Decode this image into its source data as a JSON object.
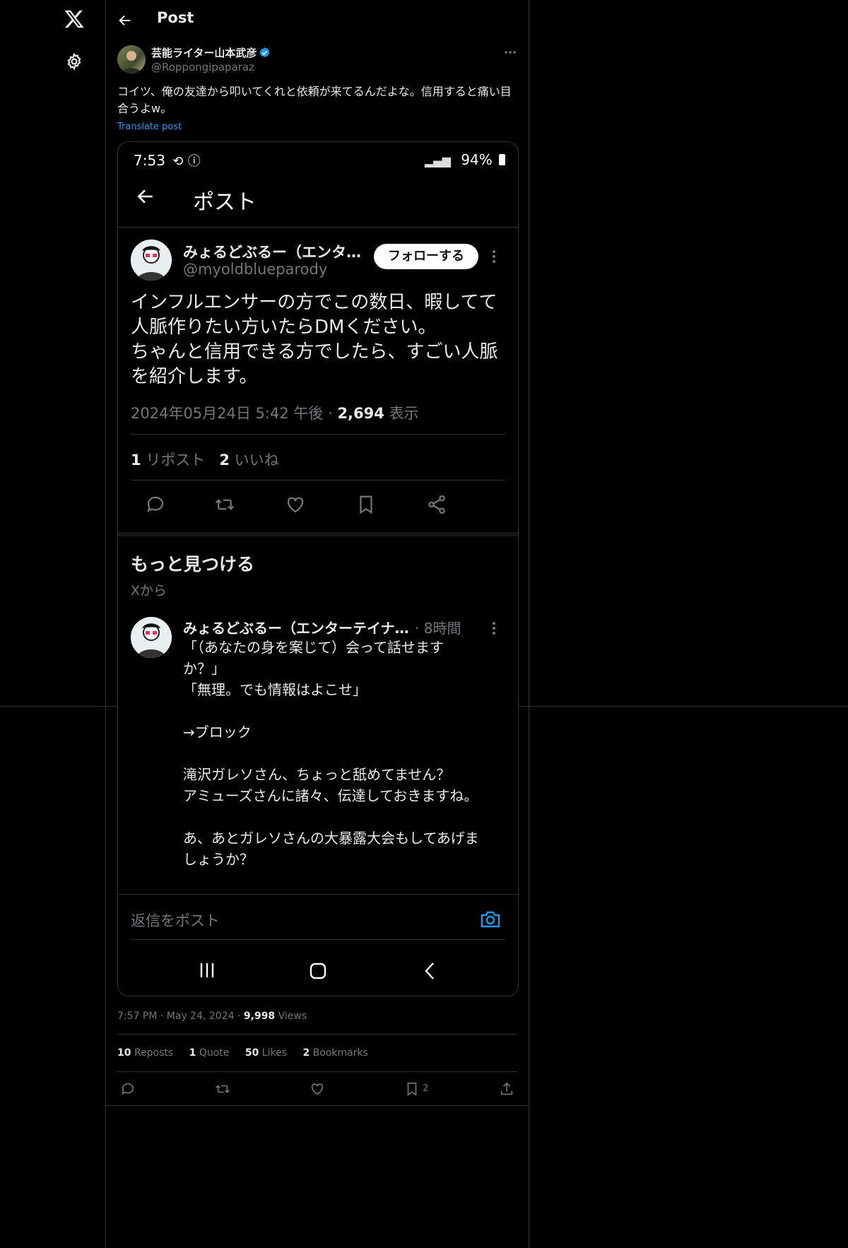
{
  "header": {
    "title": "Post"
  },
  "tweet": {
    "author_name": "芸能ライター山本武彦",
    "author_handle": "@Roppongipaparaz",
    "text": "コイツ、俺の友達から叩いてくれと依頼が来てるんだよな。信用すると痛い目合うよw。",
    "translate_label": "Translate post",
    "time": "7:57 PM",
    "date": "May 24, 2024",
    "views_count": "9,998",
    "views_label": "Views",
    "reposts_count": "10",
    "reposts_label": "Reposts",
    "quotes_count": "1",
    "quotes_label": "Quote",
    "likes_count": "50",
    "likes_label": "Likes",
    "bookmarks_count": "2",
    "bookmarks_label": "Bookmarks",
    "bookmark_action_count": "2"
  },
  "screenshot": {
    "status_time": "7:53",
    "battery": "94%",
    "title": "ポスト",
    "author_name": "みょるどぶるー（エンタ…",
    "author_handle": "@myoldblueparody",
    "follow_label": "フォローする",
    "text": "インフルエンサーの方でこの数日、暇してて\n人脈作りたい方いたらDMください。\nちゃんと信用できる方でしたら、すごい人脈\nを紹介します。",
    "datetime": "2024年05月24日 5:42 午後 ·",
    "views_count": "2,694",
    "views_label": "表示",
    "reposts_count": "1",
    "reposts_label": "リポスト",
    "likes_count": "2",
    "likes_label": "いいね",
    "discover_title": "もっと見つける",
    "discover_sub": "Xから",
    "rec_author": "みょるどぶるー（エンターテイナ…",
    "rec_time": "· 8時間",
    "rec_text": "「（あなたの身を案じて）会って話せます\nか？」\n「無理。でも情報はよこせ」\n\n→ブロック\n\n滝沢ガレソさん、ちょっと舐めてません？\nアミューズさんに諸々、伝達しておきますね。\n\nあ、あとガレソさんの大暴露大会もしてあげま\nしょうか？",
    "reply_placeholder": "返信をポスト"
  },
  "colors": {
    "accent": "#1d9bf0",
    "bg": "#000000",
    "border": "#2f3336",
    "muted": "#71767b"
  }
}
